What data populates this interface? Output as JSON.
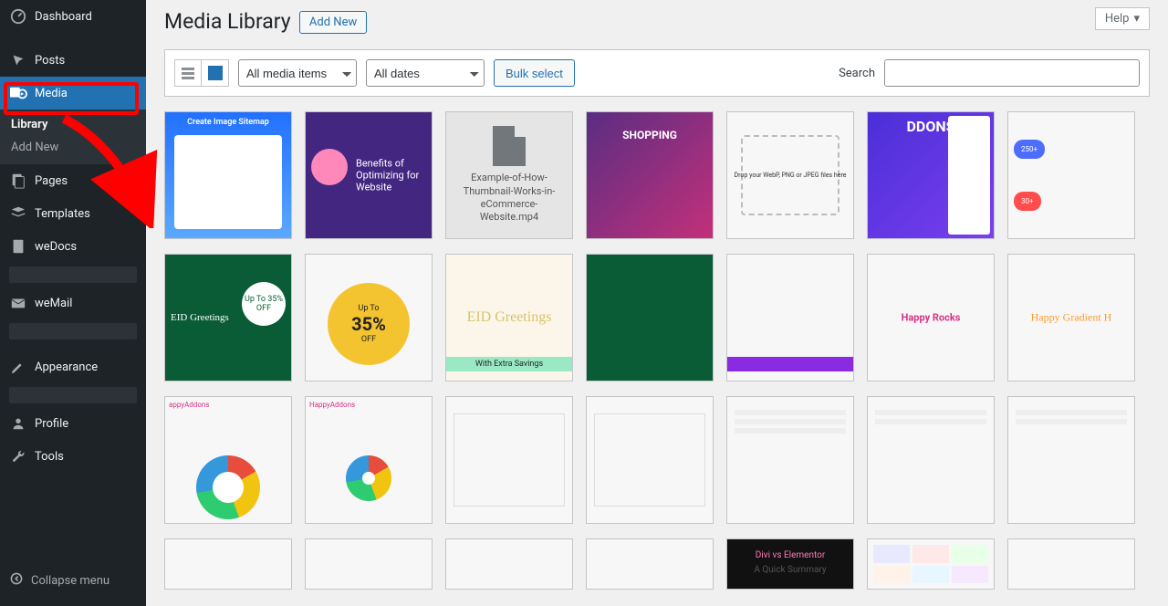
{
  "sidebar": {
    "dashboard": "Dashboard",
    "posts": "Posts",
    "media": "Media",
    "media_sub": {
      "library": "Library",
      "add_new": "Add New"
    },
    "pages": "Pages",
    "templates": "Templates",
    "wedocs": "weDocs",
    "wemail": "weMail",
    "profile": "Profile",
    "appearance": "Appearance",
    "tools": "Tools",
    "collapse": "Collapse menu"
  },
  "header": {
    "help": "Help",
    "title": "Media Library",
    "add_new": "Add New"
  },
  "toolbar": {
    "filter_type": "All media items",
    "filter_date": "All dates",
    "bulk": "Bulk select",
    "search_label": "Search",
    "search_value": ""
  },
  "thumbs": {
    "r1": [
      {
        "kind": "blue",
        "t": "Create Image Sitemap"
      },
      {
        "kind": "indigo",
        "t": "Benefits of Optimizing for Website"
      },
      {
        "kind": "video",
        "t": "Example-of-How-Thumbnail-Works-in-eCommerce-Website.mp4"
      },
      {
        "kind": "purple",
        "t": "SHOPPING"
      },
      {
        "kind": "white",
        "t": "Drop your WebP, PNG or JPEG files here"
      },
      {
        "kind": "addons",
        "t": "DDONS"
      },
      {
        "kind": "cards",
        "t": "30+"
      }
    ],
    "r2": [
      {
        "kind": "eid",
        "t": "EID Greetings",
        "badge": "Up To 35% OFF"
      },
      {
        "kind": "coin",
        "t": "Up To 35% OFF"
      },
      {
        "kind": "mint",
        "t": "EID Greetings",
        "bar": "With Extra Savings"
      },
      {
        "kind": "plain-green"
      },
      {
        "kind": "purple-ui"
      },
      {
        "kind": "rocks",
        "t": "Happy Rocks"
      },
      {
        "kind": "grad",
        "t": "Happy Gradient H"
      }
    ],
    "r3": [
      {
        "kind": "donut-a",
        "t": "appyAddons"
      },
      {
        "kind": "donut-b",
        "t": "HappyAddons"
      },
      {
        "kind": "form"
      },
      {
        "kind": "form"
      },
      {
        "kind": "list"
      },
      {
        "kind": "list"
      },
      {
        "kind": "list"
      }
    ],
    "r4": [
      {
        "kind": "form-short"
      },
      {
        "kind": "form-short"
      },
      {
        "kind": "form-short"
      },
      {
        "kind": "form-short"
      },
      {
        "kind": "divi",
        "t1": "Divi vs Elementor",
        "t2": "A Quick Summary"
      },
      {
        "kind": "grid"
      },
      {
        "kind": "form-short"
      }
    ]
  }
}
